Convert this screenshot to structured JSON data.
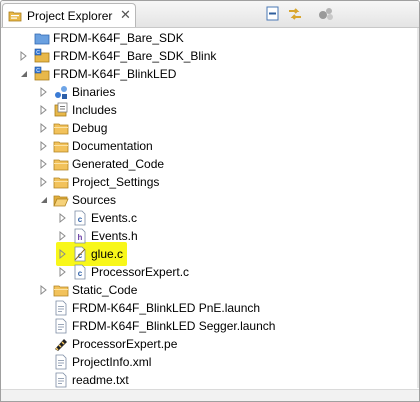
{
  "panel": {
    "tab_label": "Project Explorer",
    "close_glyph": "✕"
  },
  "toolbar": [
    {
      "name": "collapse-all-icon"
    },
    {
      "name": "link-with-editor-icon"
    },
    {
      "name": "view-menu-icon"
    }
  ],
  "tree": [
    {
      "label": "FRDM-K64F_Bare_SDK",
      "type": "project-closed",
      "expandable": false,
      "depth": 0
    },
    {
      "label": "FRDM-K64F_Bare_SDK_Blink",
      "type": "project",
      "expandable": true,
      "expanded": false,
      "depth": 0
    },
    {
      "label": "FRDM-K64F_BlinkLED",
      "type": "project",
      "expandable": true,
      "expanded": true,
      "depth": 0
    },
    {
      "label": "Binaries",
      "type": "binaries",
      "expandable": true,
      "expanded": false,
      "depth": 1
    },
    {
      "label": "Includes",
      "type": "includes",
      "expandable": true,
      "expanded": false,
      "depth": 1
    },
    {
      "label": "Debug",
      "type": "folder",
      "expandable": true,
      "expanded": false,
      "depth": 1
    },
    {
      "label": "Documentation",
      "type": "folder",
      "expandable": true,
      "expanded": false,
      "depth": 1
    },
    {
      "label": "Generated_Code",
      "type": "folder",
      "expandable": true,
      "expanded": false,
      "depth": 1
    },
    {
      "label": "Project_Settings",
      "type": "folder",
      "expandable": true,
      "expanded": false,
      "depth": 1
    },
    {
      "label": "Sources",
      "type": "folder-open",
      "expandable": true,
      "expanded": true,
      "depth": 1
    },
    {
      "label": "Events.c",
      "type": "c-file",
      "expandable": true,
      "expanded": false,
      "depth": 2
    },
    {
      "label": "Events.h",
      "type": "h-file",
      "expandable": true,
      "expanded": false,
      "depth": 2
    },
    {
      "label": "glue.c",
      "type": "c-file-excluded",
      "expandable": true,
      "expanded": false,
      "depth": 2,
      "highlighted": true
    },
    {
      "label": "ProcessorExpert.c",
      "type": "c-file",
      "expandable": true,
      "expanded": false,
      "depth": 2
    },
    {
      "label": "Static_Code",
      "type": "folder",
      "expandable": true,
      "expanded": false,
      "depth": 1
    },
    {
      "label": "FRDM-K64F_BlinkLED PnE.launch",
      "type": "file",
      "expandable": false,
      "depth": 1
    },
    {
      "label": "FRDM-K64F_BlinkLED Segger.launch",
      "type": "file",
      "expandable": false,
      "depth": 1
    },
    {
      "label": "ProcessorExpert.pe",
      "type": "pe-file",
      "expandable": false,
      "depth": 1
    },
    {
      "label": "ProjectInfo.xml",
      "type": "file",
      "expandable": false,
      "depth": 1
    },
    {
      "label": "readme.txt",
      "type": "file",
      "expandable": false,
      "depth": 1
    }
  ],
  "colors": {
    "highlight": "#f8f71a",
    "folder": "#e8b84a",
    "project_blue": "#3a7bd5"
  }
}
